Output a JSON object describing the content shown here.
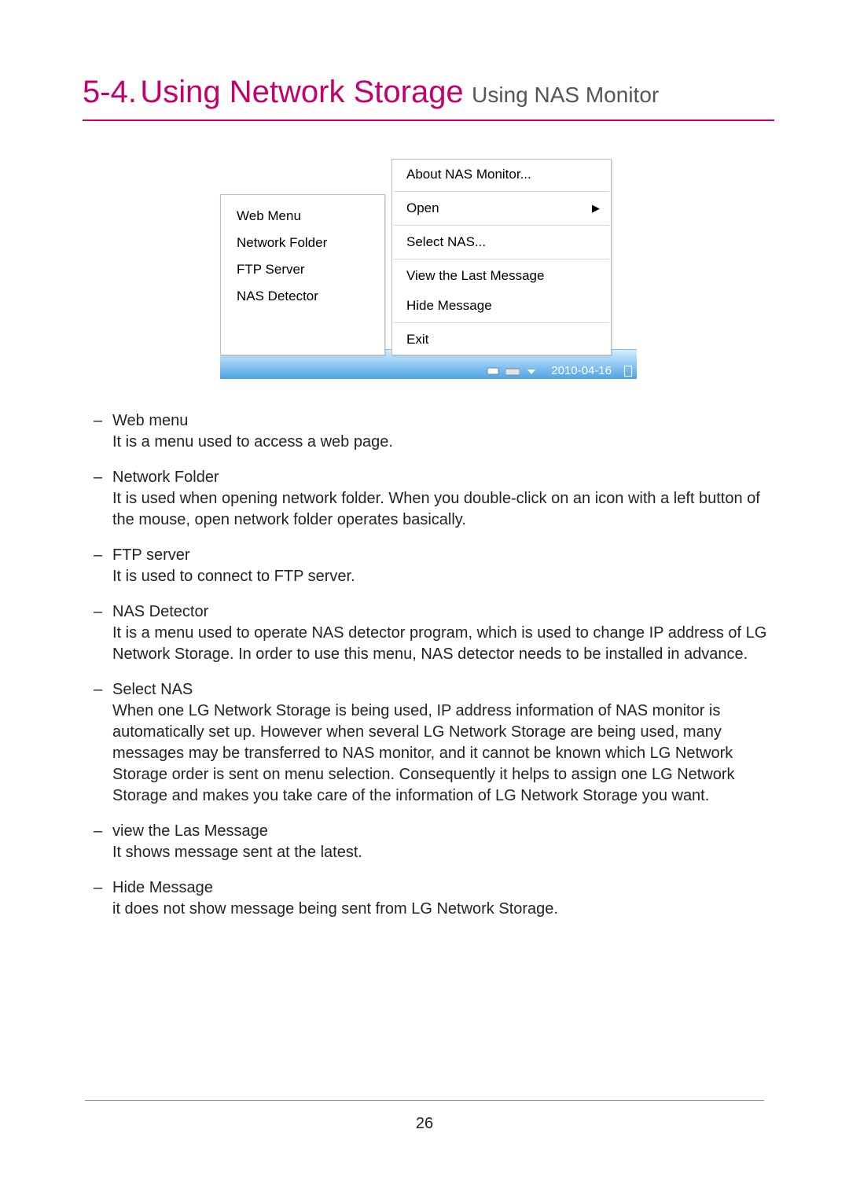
{
  "heading": {
    "section_number": "5-4.",
    "main_title": "Using Network Storage",
    "sub_title": "Using NAS Monitor"
  },
  "screenshot": {
    "left_menu": {
      "items": [
        "Web Menu",
        "Network Folder",
        "FTP Server",
        "NAS Detector"
      ]
    },
    "right_menu": {
      "about": "About NAS Monitor...",
      "open": "Open",
      "select_nas": "Select NAS...",
      "view_last": "View the Last Message",
      "hide_msg": "Hide Message",
      "exit": "Exit"
    },
    "taskbar": {
      "date": "2010-04-16"
    }
  },
  "definitions": [
    {
      "term": "Web menu",
      "desc": "It is a menu used to access a web page."
    },
    {
      "term": "Network Folder",
      "desc": "It is used when opening network folder. When you double-click on an icon with a left button of the mouse, open network folder operates basically."
    },
    {
      "term": "FTP server",
      "desc": "It is used to connect to FTP server."
    },
    {
      "term": "NAS Detector",
      "desc": "It is a menu used to operate NAS detector program, which is used to change IP address of LG Network Storage. In order to use this menu, NAS detector needs to be installed in advance."
    },
    {
      "term": "Select NAS",
      "desc": "When one LG Network Storage is being used, IP address information of NAS monitor is automatically set up. However when several LG Network Storage are being used, many messages may be transferred to NAS monitor, and it cannot be known which LG Network Storage order is sent on menu selection. Consequently it helps to assign one LG Network Storage and makes you take care of the information of LG Network Storage you want."
    },
    {
      "term": "view the Las Message",
      "desc": "It shows message sent at the latest."
    },
    {
      "term": "Hide Message",
      "desc": "it does not show message being sent from LG Network Storage."
    }
  ],
  "page_number": "26"
}
